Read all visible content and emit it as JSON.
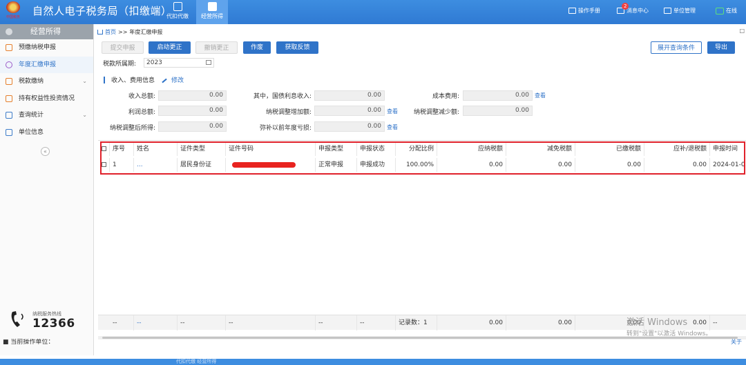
{
  "header": {
    "emblem_caption": "中国税务",
    "title": "自然人电子税务局（扣缴端）",
    "nav": [
      {
        "label": "代扣代缴",
        "icon": "document-icon",
        "active": false
      },
      {
        "label": "经营所得",
        "icon": "database-icon",
        "active": true
      }
    ],
    "right": {
      "manual": "操作手册",
      "messages": "消息中心",
      "messages_badge": "2",
      "unit_mgmt": "单位管理",
      "online": "在线"
    }
  },
  "sidebar": {
    "title": "经营所得",
    "items": [
      {
        "label": "预缴纳税申报",
        "active": false,
        "expand": false
      },
      {
        "label": "年度汇缴申报",
        "active": true,
        "expand": false
      },
      {
        "label": "税款缴纳",
        "active": false,
        "expand": true
      },
      {
        "label": "持有权益性投资情况",
        "active": false,
        "expand": false
      },
      {
        "label": "查询统计",
        "active": false,
        "expand": true
      },
      {
        "label": "单位信息",
        "active": false,
        "expand": false
      }
    ],
    "collapse": "«",
    "hotline_caption": "纳税服务热线",
    "hotline_number": "12366"
  },
  "breadcrumb": {
    "home": "首页",
    "sep": ">>",
    "current": "年度汇缴申报",
    "end": "□"
  },
  "toolbar": {
    "submit": "提交申报",
    "start_correction": "启动更正",
    "cancel_correction": "撤销更正",
    "void": "作废",
    "get_feedback": "获取反馈",
    "expand_query": "展开查询条件",
    "export": "导出"
  },
  "period": {
    "label": "税款所属期:",
    "value": "2023"
  },
  "income_section": {
    "title": "收入、费用信息",
    "edit": "修改",
    "fields": {
      "total_income": {
        "label": "收入总额:",
        "value": "0.00"
      },
      "treasury_interest": {
        "label": "其中，国债利息收入:",
        "value": "0.00"
      },
      "cost": {
        "label": "成本费用:",
        "value": "0.00"
      },
      "total_profit": {
        "label": "利润总额:",
        "value": "0.00"
      },
      "adj_increase": {
        "label": "纳税调整增加额:",
        "value": "0.00"
      },
      "adj_decrease": {
        "label": "纳税调整减少额:",
        "value": "0.00"
      },
      "adjusted_income": {
        "label": "纳税调整后所得:",
        "value": "0.00"
      },
      "loss_offset": {
        "label": "弥补以前年度亏损:",
        "value": "0.00"
      }
    },
    "view": "查看"
  },
  "table": {
    "headers": [
      "序号",
      "姓名",
      "证件类型",
      "证件号码",
      "申报类型",
      "申报状态",
      "分配比例",
      "应纳税额",
      "减免税额",
      "已缴税额",
      "应补/退税额",
      "申报时间"
    ],
    "rows": [
      {
        "index": "1",
        "name": "...",
        "id_type": "居民身份证",
        "id_number": "",
        "decl_type": "正常申报",
        "status": "申报成功",
        "ratio": "100.00%",
        "tax_payable": "0.00",
        "tax_relief": "0.00",
        "tax_paid": "0.00",
        "tax_due": "0.00",
        "time": "2024-01-0"
      }
    ],
    "footer": {
      "dash": "--",
      "count": "记录数：1",
      "tax_payable": "0.00",
      "tax_relief": "0.00",
      "tax_paid": "0.00",
      "tax_due": "0.00"
    }
  },
  "watermark": {
    "line1": "激活 Windows",
    "line2": "转到\"设置\"以激活 Windows。"
  },
  "statusbar": {
    "text": "■ 当前操作单位：",
    "close": "关于"
  },
  "bottom_band": {
    "text": "代扣代缴    经营所得"
  }
}
